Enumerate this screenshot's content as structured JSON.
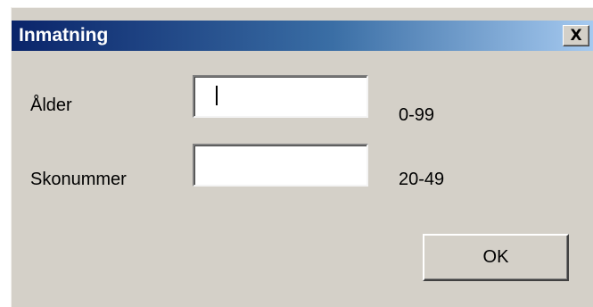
{
  "window": {
    "title": "Inmatning",
    "close_label": "X"
  },
  "form": {
    "fields": [
      {
        "label": "Ålder",
        "value": "",
        "range": "0-99"
      },
      {
        "label": "Skonummer",
        "value": "",
        "range": "20-49"
      }
    ]
  },
  "buttons": {
    "ok_label": "OK"
  },
  "colors": {
    "dialog_bg": "#d4d0c8",
    "titlebar_start": "#0a246a",
    "titlebar_end": "#a6caf0",
    "title_text": "#ffffff"
  }
}
